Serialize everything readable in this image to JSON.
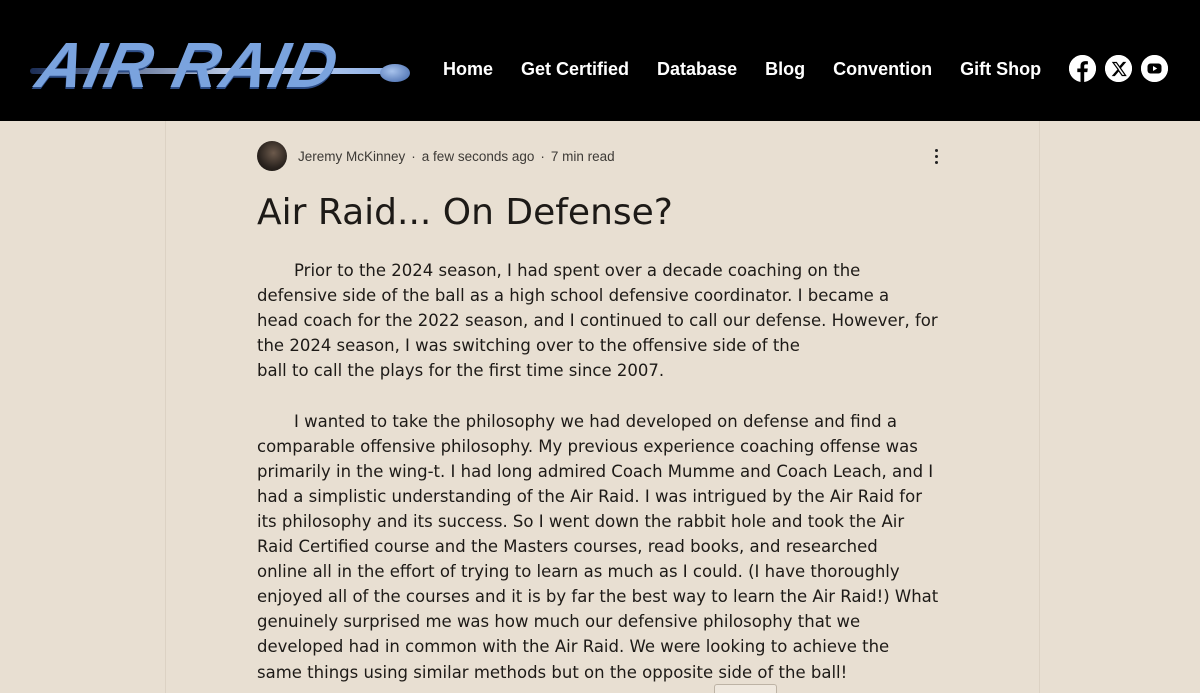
{
  "header": {
    "logo_text": "AIR RAID",
    "nav": [
      {
        "label": "Home"
      },
      {
        "label": "Get Certified"
      },
      {
        "label": "Database"
      },
      {
        "label": "Blog"
      },
      {
        "label": "Convention"
      },
      {
        "label": "Gift Shop"
      }
    ],
    "social": [
      {
        "icon": "facebook-icon"
      },
      {
        "icon": "x-icon"
      },
      {
        "icon": "youtube-icon"
      }
    ]
  },
  "post": {
    "author": "Jeremy McKinney",
    "time": "a few seconds ago",
    "read_time": "7 min read",
    "separator": "·",
    "title": "Air Raid... On Defense?",
    "paragraph1": [
      "Prior to the 2024 season, I had spent over a decade coaching on the",
      "defensive side of the ball as a high school defensive coordinator. I became a",
      "head coach for the 2022 season, and I continued to call our defense. However, for",
      "the 2024 season, I was switching over to the offensive side of the",
      "ball to call the plays for the first time since 2007."
    ],
    "paragraph2": [
      "I wanted to take the philosophy we had developed on defense and find a",
      "comparable offensive philosophy. My previous experience coaching offense was",
      "primarily in the wing-t. I had long admired Coach Mumme and Coach Leach, and I",
      "had a simplistic understanding of the Air Raid. I was intrigued by the Air Raid for",
      "its philosophy and its success. So I went down the rabbit hole and took the Air",
      "Raid Certified course and the Masters courses, read books, and researched",
      "online all in the effort of trying to learn as much as I could. (I have thoroughly",
      "enjoyed all of the courses and it is by far the best way to learn the Air Raid!) What",
      "genuinely surprised me was how much our defensive philosophy that we",
      "developed had in common with the Air Raid. We were looking to achieve the",
      "same things using similar methods but on the opposite side of the ball!"
    ]
  },
  "colors": {
    "header_bg": "#000000",
    "page_bg": "#e8dfd2",
    "logo_blue": "#7aa3de"
  }
}
